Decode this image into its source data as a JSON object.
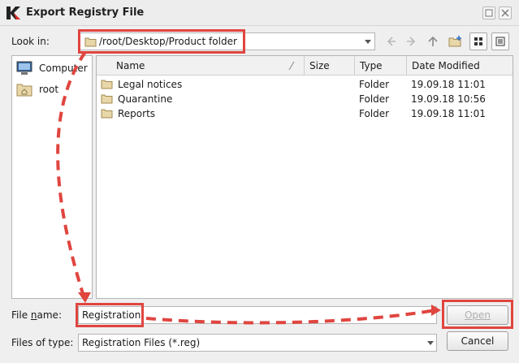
{
  "window": {
    "title": "Export Registry File",
    "buttons": [
      "minimize-icon",
      "close-icon"
    ]
  },
  "lookin": {
    "label": "Look in:",
    "path": "/root/Desktop/Product folder"
  },
  "toolbar": [
    "back-icon",
    "forward-icon",
    "parent-directory-icon",
    "new-folder-icon",
    "icon-view-icon",
    "detail-view-icon"
  ],
  "sidebar": {
    "items": [
      {
        "label": "Computer",
        "icon": "computer-icon"
      },
      {
        "label": "root",
        "icon": "home-folder-icon"
      }
    ]
  },
  "filelist": {
    "columns": [
      "Name",
      "Size",
      "Type",
      "Date Modified"
    ],
    "rows": [
      {
        "name": "Legal notices",
        "size": "",
        "type": "Folder",
        "modified": "19.09.18 11:01"
      },
      {
        "name": "Quarantine",
        "size": "",
        "type": "Folder",
        "modified": "19.09.18 10:56"
      },
      {
        "name": "Reports",
        "size": "",
        "type": "Folder",
        "modified": "19.09.18 11:01"
      }
    ]
  },
  "filename": {
    "label_pre": "File ",
    "label_accel": "n",
    "label_post": "ame:",
    "value": "Registration"
  },
  "filetype": {
    "label": "Files of type:",
    "value": "Registration Files (*.reg)"
  },
  "buttons": {
    "open": "Open",
    "cancel": "Cancel"
  },
  "colors": {
    "annotation": "#e0453f",
    "folder": "#e8d7a8"
  }
}
